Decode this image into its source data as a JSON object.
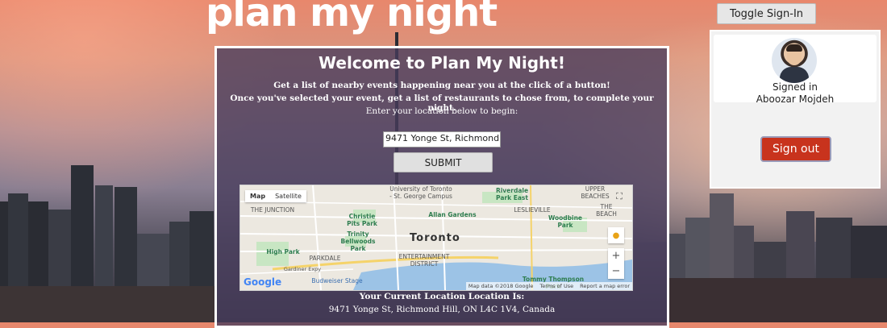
{
  "header": {
    "title": "plan my night",
    "toggle_label": "Toggle Sign-In"
  },
  "user_panel": {
    "signed_label": "Signed in",
    "name": "Aboozar Mojdeh",
    "signout_label": "Sign out"
  },
  "main": {
    "welcome": "Welcome to Plan My Night!",
    "intro_line1": "Get a list of nearby events happening near you at the click of a button!",
    "intro_line2": "Once you've selected your event, get a list of restaurants to chose from, to complete your night.",
    "intro_line3": "Enter your location below to begin:",
    "location_value": "9471 Yonge St, Richmond",
    "submit_label": "SUBMIT",
    "current_title": "Your Current Location Location Is:",
    "current_address": "9471 Yonge St, Richmond Hill, ON L4C 1V4, Canada"
  },
  "map": {
    "tab_map": "Map",
    "tab_satellite": "Satellite",
    "city": "Toronto",
    "labels": {
      "toronto_st_george": "University of Toronto - St. George Campus",
      "riverdale_park_east": "Riverdale Park East",
      "upper_beaches": "UPPER BEACHES",
      "the_junction": "THE JUNCTION",
      "christie_pits": "Christie Pits Park",
      "allan_gardens": "Allan Gardens",
      "leslieville": "LESLIEVILLE",
      "the_beach": "THE BEACH",
      "woodbine_park": "Woodbine Park",
      "trinity_bellwoods": "Trinity Bellwoods Park",
      "high_park": "High Park",
      "parkdale": "PARKDALE",
      "entertainment_district": "ENTERTAINMENT DISTRICT",
      "tommy_thompson": "Tommy Thompson Park",
      "gardiner": "Gardiner Expy",
      "budweiser_stage": "Budweiser Stage"
    },
    "google": "Google",
    "map_data": "Map data ©2018 Google",
    "terms": "Terms of Use",
    "report": "Report a map error"
  },
  "colors": {
    "signout_bg": "#c8331d",
    "panel_bg": "#483c5c",
    "accent_green": "#2e7d4f"
  }
}
